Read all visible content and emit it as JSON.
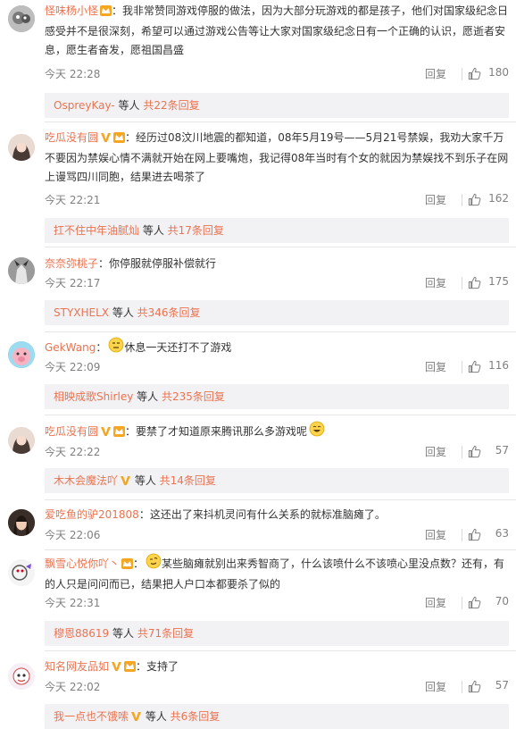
{
  "comments": [
    {
      "user": "怪味杨小怪",
      "text": "：我非常赞同游戏停服的做法，因为大部分玩游戏的都是孩子，他们对国家级纪念日感受并不是很深刻，希望可以通过游戏公告等让大家对国家级纪念日有一个正确的认识，愿逝者安息，愿生者奋发，愿祖国昌盛",
      "time": "今天 22:28",
      "reply": "回复",
      "likes": "180",
      "sub_user": "OspreyKay-",
      "sub_mid": " 等人 ",
      "sub_count": "共22条回复"
    },
    {
      "user": "吃瓜没有圆",
      "text": "：经历过08汶川地震的都知道，08年5月19号——5月21号禁娱，我劝大家千万不要因为禁娱心情不满就开始在网上要嘴炮，我记得08年当时有个女的就因为禁娱找不到乐子在网上谩骂四川同胞，结果进去喝茶了",
      "time": "今天 22:21",
      "reply": "回复",
      "likes": "162",
      "sub_user": "扛不住中年油腻灿",
      "sub_mid": " 等人 ",
      "sub_count": "共17条回复"
    },
    {
      "user": "奈奈弥桃子",
      "text": "：你停服就停服补偿就行",
      "time": "今天 22:17",
      "reply": "回复",
      "likes": "175",
      "sub_user": "STYXHELX",
      "sub_mid": " 等人 ",
      "sub_count": "共346条回复"
    },
    {
      "user": "GekWang",
      "text": "休息一天还打不了游戏",
      "time": "今天 22:09",
      "reply": "回复",
      "likes": "116",
      "sub_user": "相映成歌Shirley",
      "sub_mid": " 等人 ",
      "sub_count": "共235条回复"
    },
    {
      "user": "吃瓜没有圆",
      "text": "：要禁了才知道原来腾讯那么多游戏呢",
      "time": "今天 22:22",
      "reply": "回复",
      "likes": "57",
      "sub_user": "木木会魔法吖",
      "sub_mid": " 等人 ",
      "sub_count": "共14条回复"
    },
    {
      "user": "爱吃鱼的驴201808",
      "text": "：这还出了来抖机灵问有什么关系的就标准脑瘫了。",
      "time": "今天 22:06",
      "reply": "回复",
      "likes": "63"
    },
    {
      "user": "飘雪心悦你吖丶",
      "text": "某些脑瘫就别出来秀智商了，什么该喷什么不该喷心里没点数？还有，有的人只是问问而已，结果把人户口本都要杀了似的",
      "time": "今天 22:31",
      "reply": "回复",
      "likes": "70",
      "sub_user": "穆恩88619",
      "sub_mid": " 等人 ",
      "sub_count": "共71条回复"
    },
    {
      "user": "知名网友品如",
      "text": "：支持了",
      "time": "今天 22:02",
      "reply": "回复",
      "likes": "57",
      "sub_user": "我一点也不饿嗦",
      "sub_mid": " 等人 ",
      "sub_count": "共6条回复"
    }
  ],
  "icons": {
    "like": "thumbs-up-icon",
    "vip": "vip-crown-icon",
    "verified": "v-verified-icon",
    "emoji": "smiley-emoji-icon"
  },
  "colors": {
    "username": "#eb7350",
    "gold_v": "#f5a623",
    "text": "#333333",
    "muted": "#808080",
    "sub_bg": "#f2f2f5"
  }
}
